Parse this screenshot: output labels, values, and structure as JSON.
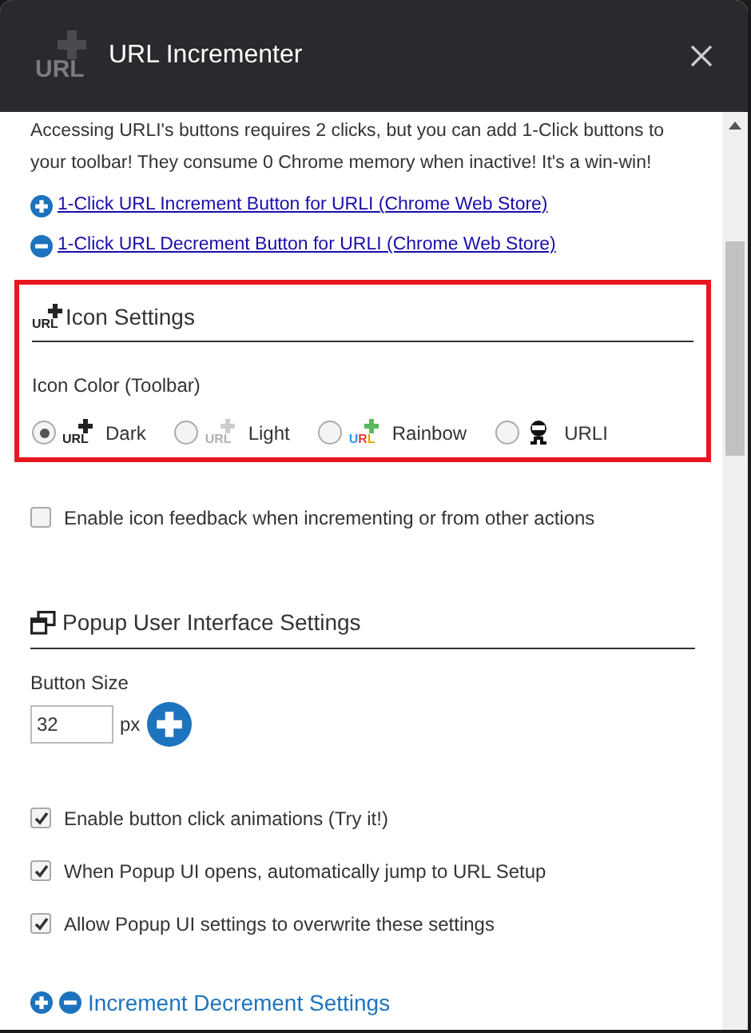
{
  "window": {
    "title": "URL Incrementer",
    "logo_text": "URL"
  },
  "intro": "Accessing URLI's buttons requires 2 clicks, but you can add 1-Click buttons to your toolbar! They consume 0 Chrome memory when inactive! It's a win-win!",
  "links": [
    {
      "kind": "plus",
      "label": "1-Click URL Increment Button for URLI (Chrome Web Store)"
    },
    {
      "kind": "minus",
      "label": "1-Click URL Decrement Button for URLI (Chrome Web Store)"
    }
  ],
  "icon_settings": {
    "heading_icon_text": "URL",
    "heading": "Icon Settings",
    "label": "Icon Color (Toolbar)",
    "options": [
      {
        "kind": "dark",
        "icon_text": "URL",
        "label": "Dark",
        "selected": true
      },
      {
        "kind": "light",
        "icon_text": "URL",
        "label": "Light",
        "selected": false
      },
      {
        "kind": "rainbow",
        "icon_text": "URL",
        "label": "Rainbow",
        "selected": false
      },
      {
        "kind": "urli",
        "label": "URLI",
        "selected": false
      }
    ],
    "feedback": {
      "label": "Enable icon feedback when incrementing or from other actions",
      "checked": false
    }
  },
  "popup_settings": {
    "heading": "Popup User Interface Settings",
    "button_size_label": "Button Size",
    "button_size": "32",
    "unit": "px",
    "options": [
      {
        "label": "Enable button click animations (Try it!)",
        "checked": true
      },
      {
        "label": "When Popup UI opens, automatically jump to URL Setup",
        "checked": true
      },
      {
        "label": "Allow Popup UI settings to overwrite these settings",
        "checked": true
      }
    ]
  },
  "next_heading": "Increment Decrement Settings"
}
